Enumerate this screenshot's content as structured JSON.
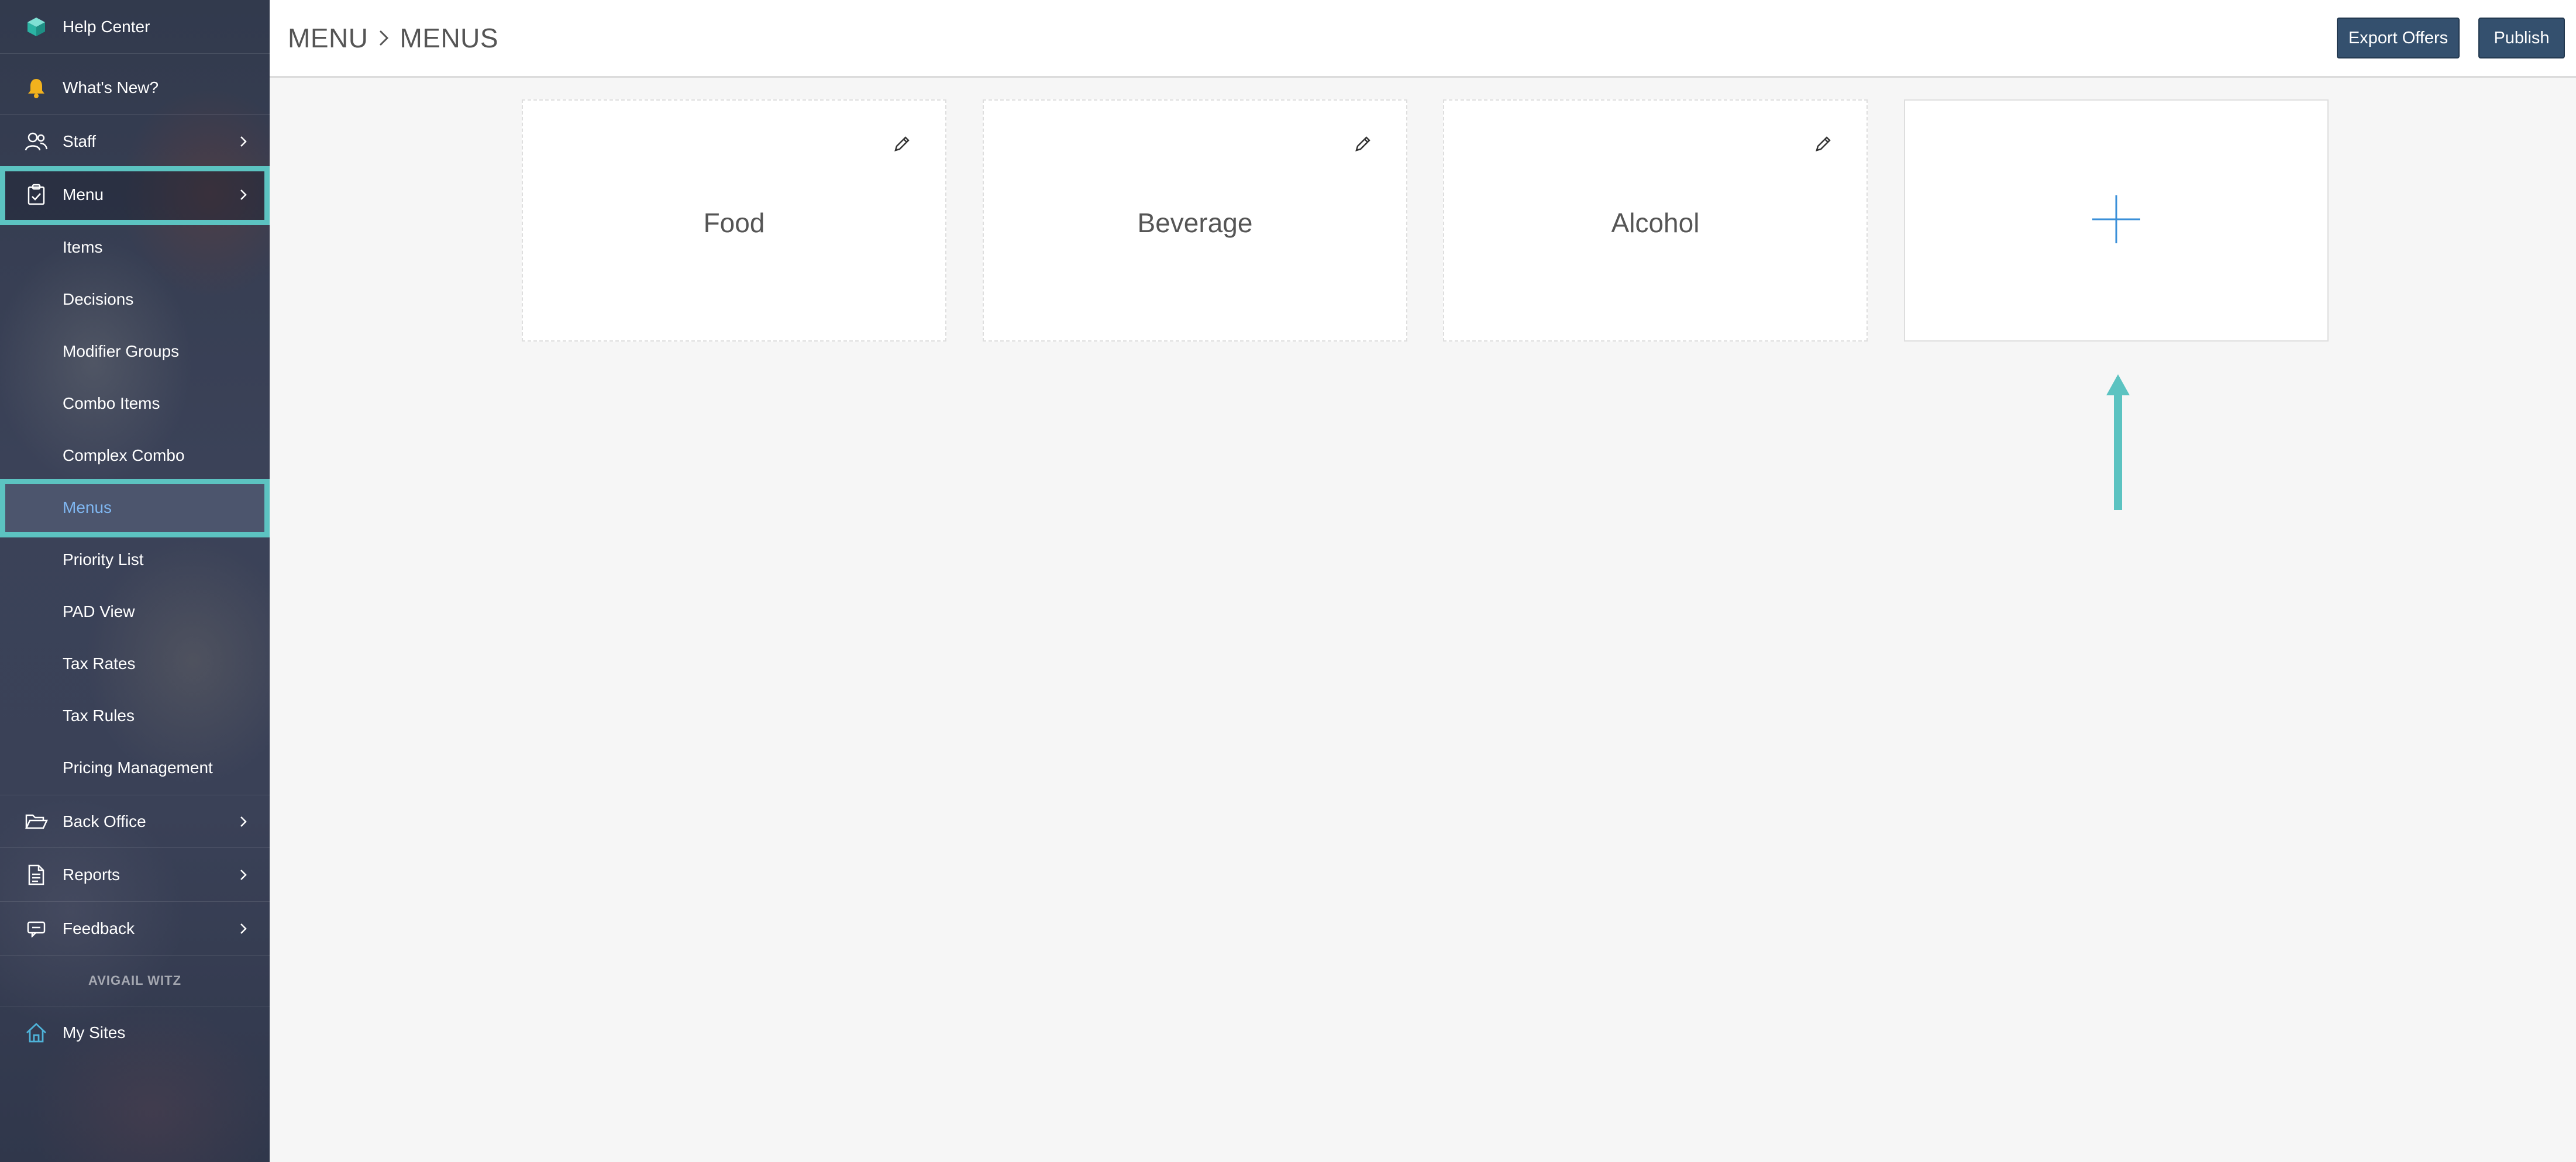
{
  "sidebar": {
    "top_items": [
      {
        "label": "Help Center",
        "icon": "cube-icon"
      },
      {
        "label": "What's New?",
        "icon": "bell-icon"
      },
      {
        "label": "Staff",
        "icon": "users-icon"
      },
      {
        "label": "Menu",
        "icon": "clipboard-icon"
      }
    ],
    "menu_sub_items": [
      {
        "label": "Items"
      },
      {
        "label": "Decisions"
      },
      {
        "label": "Modifier Groups"
      },
      {
        "label": "Combo Items"
      },
      {
        "label": "Complex Combo"
      },
      {
        "label": "Menus",
        "active": true
      },
      {
        "label": "Priority List"
      },
      {
        "label": "PAD View"
      },
      {
        "label": "Tax Rates"
      },
      {
        "label": "Tax Rules"
      },
      {
        "label": "Pricing Management"
      }
    ],
    "bottom_items": [
      {
        "label": "Back Office",
        "icon": "folder-open-icon"
      },
      {
        "label": "Reports",
        "icon": "document-icon"
      },
      {
        "label": "Feedback",
        "icon": "feedback-icon"
      }
    ],
    "user_name": "AVIGAIL WITZ",
    "my_sites": {
      "label": "My Sites",
      "icon": "home-icon"
    }
  },
  "header": {
    "breadcrumb": [
      "MENU",
      "MENUS"
    ],
    "export_label": "Export Offers",
    "publish_label": "Publish"
  },
  "cards": [
    {
      "title": "Food"
    },
    {
      "title": "Beverage"
    },
    {
      "title": "Alcohol"
    }
  ],
  "colors": {
    "highlight": "#5cc3c1",
    "button": "#34506e",
    "active_link": "#7fb6f0",
    "plus": "#3a8fd8"
  }
}
